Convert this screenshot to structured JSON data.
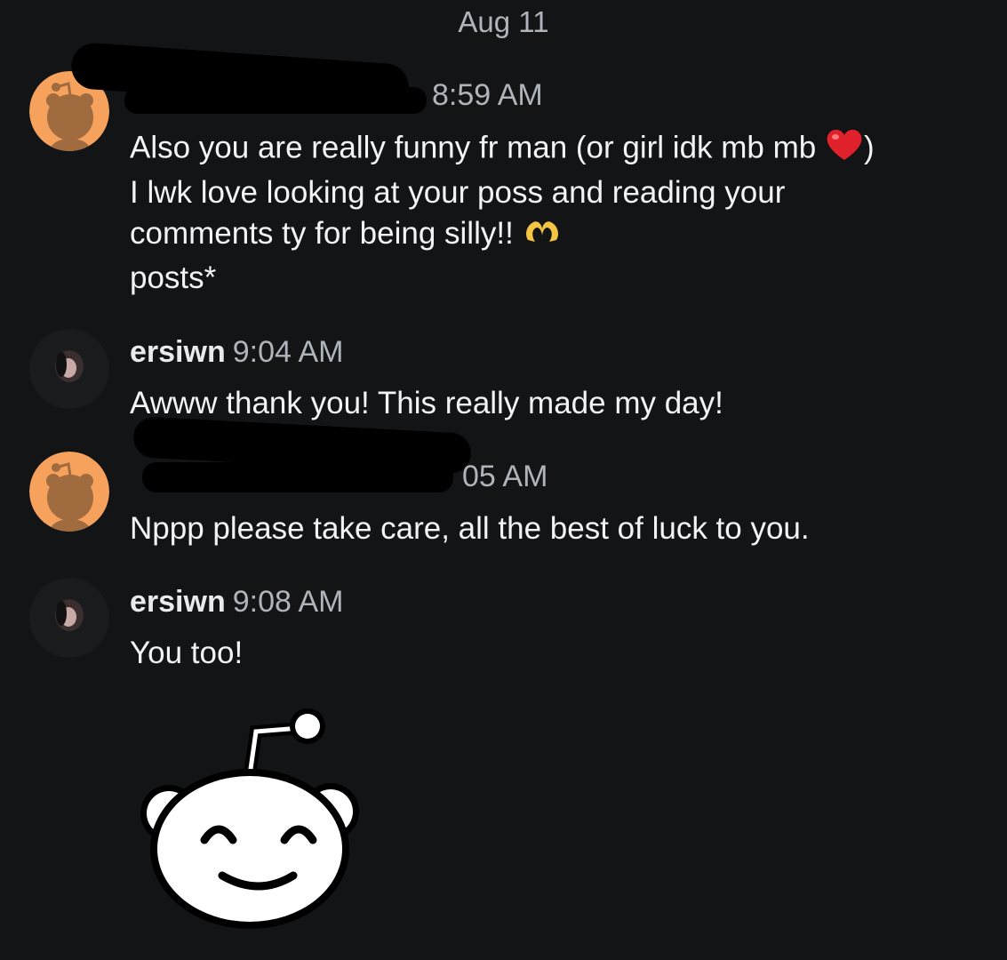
{
  "date_divider": "Aug 11",
  "messages": [
    {
      "username": "",
      "time": "8:59 AM",
      "avatar_icon": "reddit-snoo-avatar-icon",
      "lines": [
        "Also you are really funny fr man (or girl idk mb mb ",
        ")",
        "I lwk love looking at your poss and reading your",
        "comments ty for being silly!! "
      ],
      "emojis": [
        "red-heart-icon",
        "heart-hands-icon"
      ],
      "followup": "posts*"
    },
    {
      "username": "ersiwn",
      "time": "9:04 AM",
      "avatar_icon": "user-photo-avatar",
      "text": "Awww thank you! This really made my day!"
    },
    {
      "username": "",
      "time": "05 AM",
      "avatar_icon": "reddit-snoo-avatar-icon",
      "text": "Nppp please take care, all the best of luck to you."
    },
    {
      "username": "ersiwn",
      "time": "9:08 AM",
      "avatar_icon": "user-photo-avatar",
      "text": "You too!"
    }
  ],
  "sticker": {
    "icon": "smiling-snoo-sticker-icon"
  },
  "colors": {
    "background": "#121416",
    "avatar_orange": "#f6a15c",
    "snoo_brown": "#a06b3f",
    "timestamp_gray": "#aeb4ba"
  }
}
